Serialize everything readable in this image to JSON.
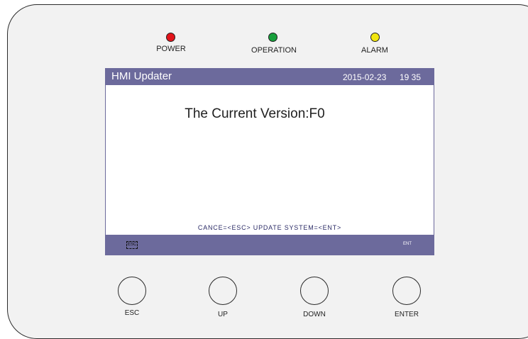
{
  "indicators": [
    {
      "label": "POWER",
      "color": "#e3141b"
    },
    {
      "label": "OPERATION",
      "color": "#18a03c"
    },
    {
      "label": "ALARM",
      "color": "#f2e60f"
    }
  ],
  "screen": {
    "header": {
      "title": "HMI Updater",
      "date": "2015-02-23",
      "time": "19 35"
    },
    "version_text": "The Current Version:F0",
    "hint": "CANCE=<ESC>  UPDATE SYSTEM=<ENT>",
    "footer": {
      "esc": "ESC",
      "ent": "ENT"
    },
    "colors": {
      "bar": "#6c6a9c",
      "body": "#ffffff"
    }
  },
  "buttons": [
    {
      "label": "ESC"
    },
    {
      "label": "UP"
    },
    {
      "label": "DOWN"
    },
    {
      "label": "ENTER"
    }
  ]
}
